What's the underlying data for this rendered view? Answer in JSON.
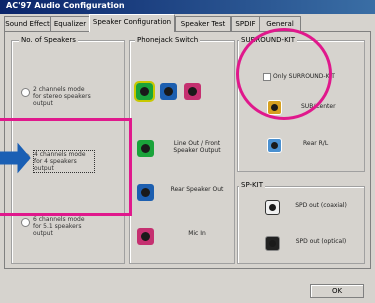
{
  "window": {
    "title": "AC'97 Audio Configuration"
  },
  "tabs": [
    {
      "label": "Sound Effect"
    },
    {
      "label": "Equalizer"
    },
    {
      "label": "Speaker Configuration"
    },
    {
      "label": "Speaker Test"
    },
    {
      "label": "SPDIF"
    },
    {
      "label": "General"
    }
  ],
  "speakers": {
    "title": "No. of Speakers",
    "options": [
      {
        "label": "2 channels mode for stereo speakers output",
        "selected": false
      },
      {
        "label": "4 channels mode for 4 speakers output",
        "selected": true
      },
      {
        "label": "6 channels mode for 5.1 speakers output",
        "selected": false
      }
    ]
  },
  "phonejack": {
    "title": "Phonejack Switch",
    "jacks": [
      {
        "label": "Line Out / Front Speaker Output",
        "color": "#1aa33a"
      },
      {
        "label": "Rear Speaker Out",
        "color": "#1d5fb0"
      },
      {
        "label": "Mic In",
        "color": "#c53070"
      }
    ]
  },
  "surround": {
    "title": "SURROUND-KIT",
    "checkbox": "Only SURROUND-KIT",
    "sub_center": "SUB/Center",
    "rear_rl": "Rear R/L"
  },
  "spkit": {
    "title": "SP-KIT",
    "coaxial": "SPD out (coaxial)",
    "optical": "SPD out (optical)"
  },
  "ok_button": "OK"
}
